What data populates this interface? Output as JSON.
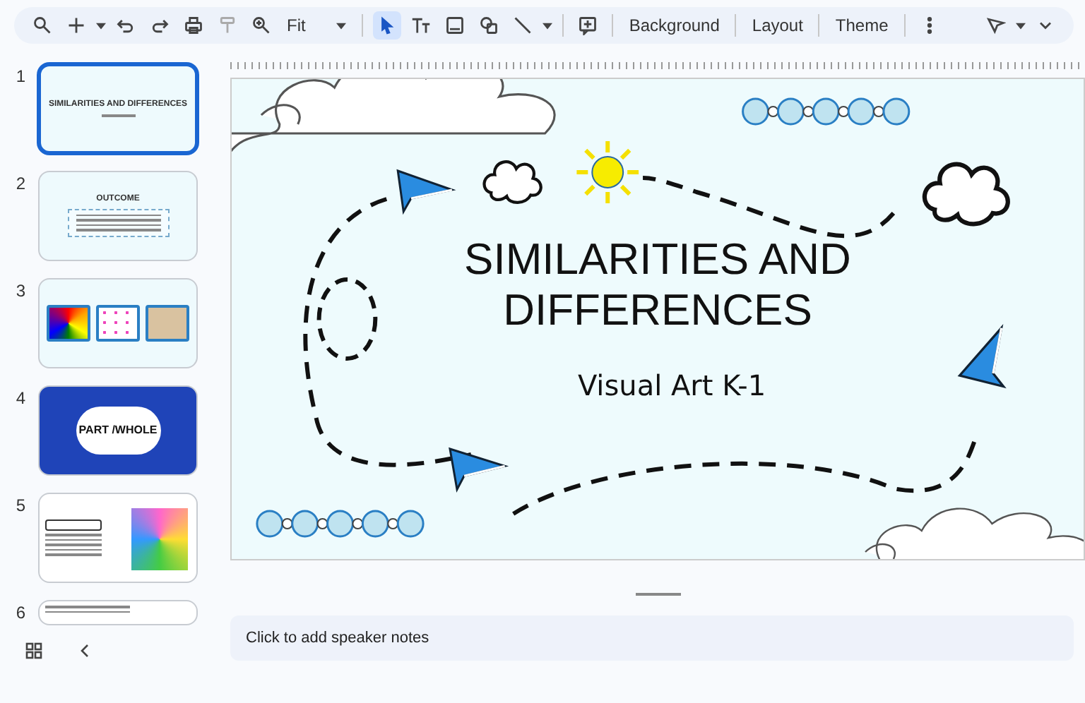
{
  "toolbar": {
    "zoom": {
      "value": "Fit"
    },
    "tools": [
      {
        "kind": "select",
        "selected": true
      },
      {
        "kind": "textbox",
        "selected": false
      },
      {
        "kind": "image",
        "selected": false
      },
      {
        "kind": "shape",
        "selected": false
      },
      {
        "kind": "line",
        "selected": false
      }
    ],
    "buttons": [
      "Background",
      "Layout",
      "Theme"
    ]
  },
  "slides": [
    {
      "number": "1",
      "selected": true,
      "kind": "title",
      "title": "SIMILARITIES AND DIFFERENCES"
    },
    {
      "number": "2",
      "selected": false,
      "kind": "outcome",
      "title": "OUTCOME"
    },
    {
      "number": "3",
      "selected": false,
      "kind": "images"
    },
    {
      "number": "4",
      "selected": false,
      "kind": "partwhole",
      "title": "PART /WHOLE"
    },
    {
      "number": "5",
      "selected": false,
      "kind": "tiedye"
    },
    {
      "number": "6",
      "selected": false,
      "kind": "text"
    }
  ],
  "slide": {
    "title": "SIMILARITIES AND DIFFERENCES",
    "subtitle": "Visual Art K-1"
  },
  "speaker_notes": {
    "placeholder": "Click to add speaker notes"
  }
}
